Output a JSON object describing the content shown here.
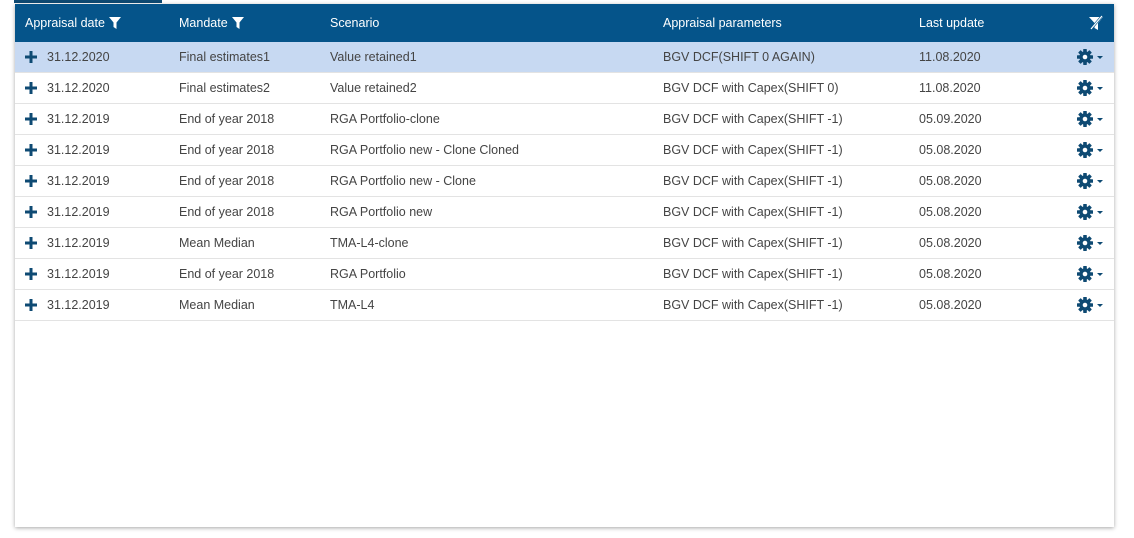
{
  "header": {
    "appraisal_date": "Appraisal date",
    "mandate": "Mandate",
    "scenario": "Scenario",
    "appraisal_parameters": "Appraisal parameters",
    "last_update": "Last update"
  },
  "rows": [
    {
      "date": "31.12.2020",
      "mandate": "Final estimates1",
      "scenario": "Value retained1",
      "parameters": "BGV DCF(SHIFT 0 AGAIN)",
      "last_update": "11.08.2020",
      "selected": true
    },
    {
      "date": "31.12.2020",
      "mandate": "Final estimates2",
      "scenario": "Value retained2",
      "parameters": "BGV DCF with Capex(SHIFT 0)",
      "last_update": "11.08.2020",
      "selected": false
    },
    {
      "date": "31.12.2019",
      "mandate": "End of year 2018",
      "scenario": "RGA Portfolio-clone",
      "parameters": "BGV DCF with Capex(SHIFT -1)",
      "last_update": "05.09.2020",
      "selected": false
    },
    {
      "date": "31.12.2019",
      "mandate": "End of year 2018",
      "scenario": "RGA Portfolio new - Clone Cloned",
      "parameters": "BGV DCF with Capex(SHIFT -1)",
      "last_update": "05.08.2020",
      "selected": false
    },
    {
      "date": "31.12.2019",
      "mandate": "End of year 2018",
      "scenario": "RGA Portfolio new - Clone",
      "parameters": "BGV DCF with Capex(SHIFT -1)",
      "last_update": "05.08.2020",
      "selected": false
    },
    {
      "date": "31.12.2019",
      "mandate": "End of year 2018",
      "scenario": "RGA Portfolio new",
      "parameters": "BGV DCF with Capex(SHIFT -1)",
      "last_update": "05.08.2020",
      "selected": false
    },
    {
      "date": "31.12.2019",
      "mandate": "Mean Median",
      "scenario": "TMA-L4-clone",
      "parameters": "BGV DCF with Capex(SHIFT -1)",
      "last_update": "05.08.2020",
      "selected": false
    },
    {
      "date": "31.12.2019",
      "mandate": "End of year 2018",
      "scenario": "RGA Portfolio",
      "parameters": "BGV DCF with Capex(SHIFT -1)",
      "last_update": "05.08.2020",
      "selected": false
    },
    {
      "date": "31.12.2019",
      "mandate": "Mean Median",
      "scenario": "TMA-L4",
      "parameters": "BGV DCF with Capex(SHIFT -1)",
      "last_update": "05.08.2020",
      "selected": false
    }
  ],
  "icons": {
    "filter": "filter-icon",
    "clear_filter": "clear-filter-icon",
    "expand": "plus-icon",
    "actions": "gear-dropdown-icon"
  },
  "colors": {
    "header_bg": "#05548a",
    "selected_row": "#c7d9f2",
    "icon": "#0e4a73"
  }
}
